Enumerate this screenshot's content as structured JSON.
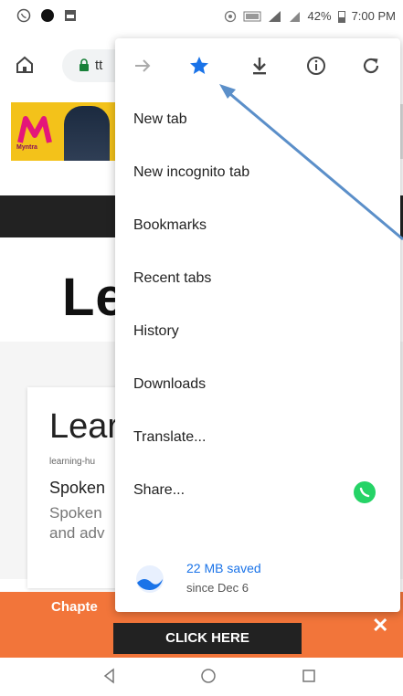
{
  "status": {
    "battery_percent": "42%",
    "time": "7:00 PM"
  },
  "address": {
    "url_fragment": "tt"
  },
  "ad": {
    "logo_text": "Myntra"
  },
  "page": {
    "big_title": "Le",
    "card_title": "Lear",
    "card_sub": "learning-hu",
    "card_head": "Spoken",
    "card_body1": "Spoken",
    "card_body2": "and adv",
    "orange_text": "Chapte",
    "click_here": "CLICK HERE",
    "close": "✕"
  },
  "menu": {
    "items": [
      {
        "label": "New tab"
      },
      {
        "label": "New incognito tab"
      },
      {
        "label": "Bookmarks"
      },
      {
        "label": "Recent tabs"
      },
      {
        "label": "History"
      },
      {
        "label": "Downloads"
      },
      {
        "label": "Translate..."
      },
      {
        "label": "Share..."
      }
    ],
    "saved_main": "22 MB saved",
    "saved_sub": "since Dec 6"
  },
  "colors": {
    "accent_blue": "#1a73e8",
    "orange_banner": "#f2753a",
    "whatsapp_green": "#25d366"
  }
}
